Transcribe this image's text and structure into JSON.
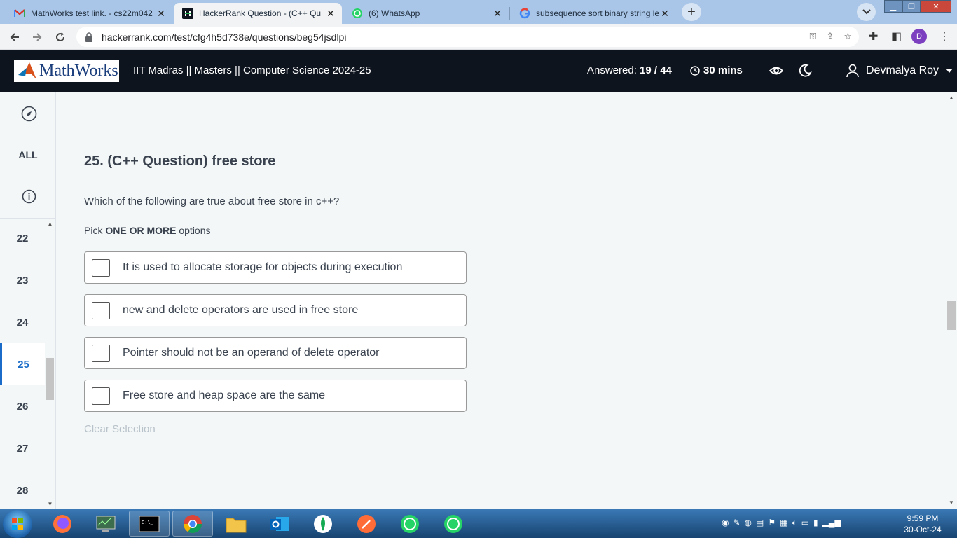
{
  "browser": {
    "tabs": [
      {
        "title": "MathWorks test link. - cs22m042",
        "icon": "gmail-icon"
      },
      {
        "title": "HackerRank Question - (C++ Qu",
        "icon": "hackerrank-icon"
      },
      {
        "title": "(6) WhatsApp",
        "icon": "whatsapp-icon"
      },
      {
        "title": "subsequence sort binary string le",
        "icon": "google-icon"
      }
    ],
    "url": "hackerrank.com/test/cfg4h5d738e/questions/beg54jsdlpi",
    "profile_initial": "D"
  },
  "header": {
    "logo_text": "MathWorks",
    "test_title": "IIT Madras || Masters || Computer Science 2024-25",
    "answered_label": "Answered:",
    "answered_value": "19 / 44",
    "timer": "30 mins",
    "user_name": "Devmalya Roy"
  },
  "sidebar": {
    "all_label": "ALL",
    "questions": [
      "22",
      "23",
      "24",
      "25",
      "26",
      "27",
      "28"
    ],
    "current": "25"
  },
  "question": {
    "title": "25. (C++ Question) free store",
    "text": "Which of the following are true about free store in c++?",
    "pick_prefix": "Pick",
    "pick_bold": "ONE OR MORE",
    "pick_suffix": "options",
    "options": [
      "It is used to allocate storage for objects during execution",
      "new and delete operators are used in free store",
      "Pointer should not be an operand of delete operator",
      "Free store and heap space are the same"
    ],
    "clear_label": "Clear Selection"
  },
  "taskbar": {
    "time": "9:59 PM",
    "date": "30-Oct-24"
  }
}
